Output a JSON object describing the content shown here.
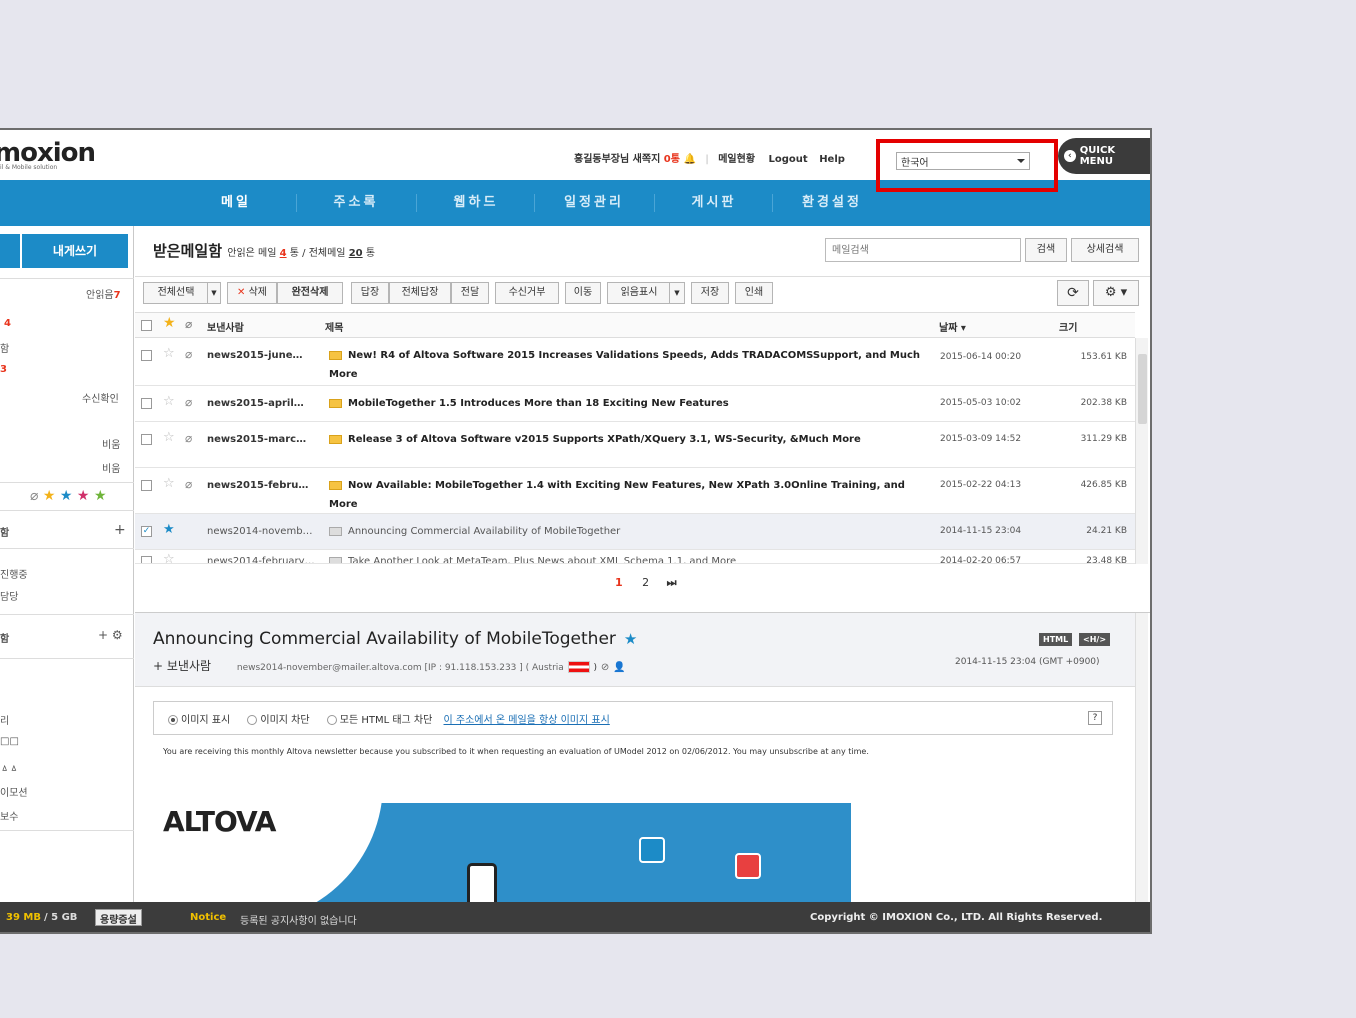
{
  "header": {
    "logo": "moxion",
    "logo_sub": "il & Mobile solution",
    "user_greeting": "홍길동부장님 새쪽지",
    "new_notes": "0통",
    "mail_status": "메일현황",
    "logout": "Logout",
    "help": "Help",
    "language": "한국어",
    "quick_menu": "QUICK MENU"
  },
  "nav": {
    "items": [
      "메일",
      "주소록",
      "웹하드",
      "일정관리",
      "게시판",
      "환경설정"
    ]
  },
  "sidebar": {
    "write_label": "내게쓰기",
    "unread_label": "안읽음",
    "unread_count": "7",
    "count_a": "4",
    "label_a": "함",
    "count_b": "3",
    "receipt": "수신확인",
    "private1": "비움",
    "private2": "비움",
    "section1": "함",
    "item_a": "진행중",
    "item_b": "담당",
    "section2": "함",
    "item_c": "리",
    "item_d": "□□",
    "item_e": "ㅿㅿ",
    "item_f": "이모션",
    "item_g": "보수"
  },
  "mailbox": {
    "title": "받은메일함",
    "unread_prefix": "안읽은 메일",
    "unread_count": "4",
    "unread_suffix": "통 / 전체메일",
    "total_count": "20",
    "total_suffix": "통",
    "search_placeholder": "메일검색",
    "search_btn": "검색",
    "detail_search_btn": "상세검색"
  },
  "toolbar": {
    "select_all": "전체선택",
    "delete": "삭제",
    "purge": "완전삭제",
    "reply": "답장",
    "reply_all": "전체답장",
    "forward": "전달",
    "block": "수신거부",
    "move": "이동",
    "mark_read": "읽음표시",
    "save": "저장",
    "print": "인쇄"
  },
  "list_head": {
    "sender": "보낸사람",
    "subject": "제목",
    "date": "날짜",
    "size": "크기"
  },
  "mails": [
    {
      "sender": "news2015-june…",
      "subject": "New! R4 of Altova Software 2015 Increases Validations Speeds, Adds TRADACOMSSupport, and Much More",
      "date": "2015-06-14 00:20",
      "size": "153.61 KB"
    },
    {
      "sender": "news2015-april…",
      "subject": "MobileTogether 1.5 Introduces More than 18 Exciting New Features",
      "date": "2015-05-03 10:02",
      "size": "202.38 KB"
    },
    {
      "sender": "news2015-marc…",
      "subject": "Release 3 of Altova Software v2015 Supports XPath/XQuery 3.1, WS-Security, &Much More",
      "date": "2015-03-09 14:52",
      "size": "311.29 KB"
    },
    {
      "sender": "news2015-febru…",
      "subject": "Now Available: MobileTogether 1.4 with Exciting New Features, New XPath 3.0Online Training, and More",
      "date": "2015-02-22 04:13",
      "size": "426.85 KB"
    },
    {
      "sender": "news2014-novemb…",
      "subject": "Announcing Commercial Availability of MobileTogether",
      "date": "2014-11-15 23:04",
      "size": "24.21 KB"
    },
    {
      "sender": "news2014-february…",
      "subject": "Take Another Look at MetaTeam, Plus News about XML Schema 1.1, and More",
      "date": "2014-02-20 06:57",
      "size": "23.48 KB"
    }
  ],
  "pager": {
    "current": "1",
    "next": "2"
  },
  "preview": {
    "title": "Announcing Commercial Availability of MobileTogether",
    "tag_html": "HTML",
    "tag_source": "<H/>",
    "from_label": "+ 보낸사람",
    "from_addr": "news2014-november@mailer.altova.com [IP : 91.118.153.233 ] ( Austria",
    "from_close": ")",
    "date": "2014-11-15 23:04 (GMT +0900)",
    "opt_show": "이미지 표시",
    "opt_block": "이미지 차단",
    "opt_block_html": "모든 HTML 태그 차단",
    "opt_link": "이 주소에서 온 메일을 항상 이미지 표시",
    "body_text": "You are receiving this monthly Altova newsletter because you subscribed to it when requesting an evaluation of UModel 2012 on 02/06/2012. You may unsubscribe at any time.",
    "banner_logo": "ALTOVA"
  },
  "footer": {
    "used": "39 MB",
    "total": "/ 5 GB",
    "expand": "용량증설",
    "notice_label": "Notice",
    "notice": "등록된 공지사항이 없습니다",
    "copyright": "Copyright © IMOXION Co., LTD. All Rights Reserved."
  }
}
